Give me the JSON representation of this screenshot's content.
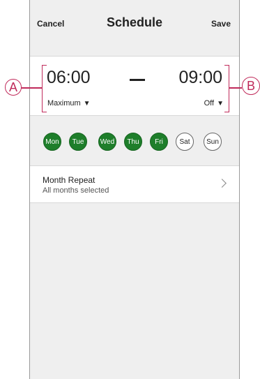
{
  "header": {
    "cancel_label": "Cancel",
    "title": "Schedule",
    "save_label": "Save"
  },
  "time_range": {
    "start_time": "06:00",
    "end_time": "09:00",
    "start_mode": "Maximum",
    "end_mode": "Off",
    "dropdown_caret": "▼"
  },
  "days": [
    {
      "label": "Mon",
      "selected": true
    },
    {
      "label": "Tue",
      "selected": true
    },
    {
      "label": "Wed",
      "selected": true
    },
    {
      "label": "Thu",
      "selected": true
    },
    {
      "label": "Fri",
      "selected": true
    },
    {
      "label": "Sat",
      "selected": false
    },
    {
      "label": "Sun",
      "selected": false
    }
  ],
  "month_repeat": {
    "title": "Month Repeat",
    "subtitle": "All months selected",
    "icon": "chevron-right-icon"
  },
  "annotations": {
    "left_label": "A",
    "right_label": "B"
  },
  "colors": {
    "selected_day": "#1e7e2a",
    "annotation": "#c02a5a",
    "background": "#efefef"
  }
}
